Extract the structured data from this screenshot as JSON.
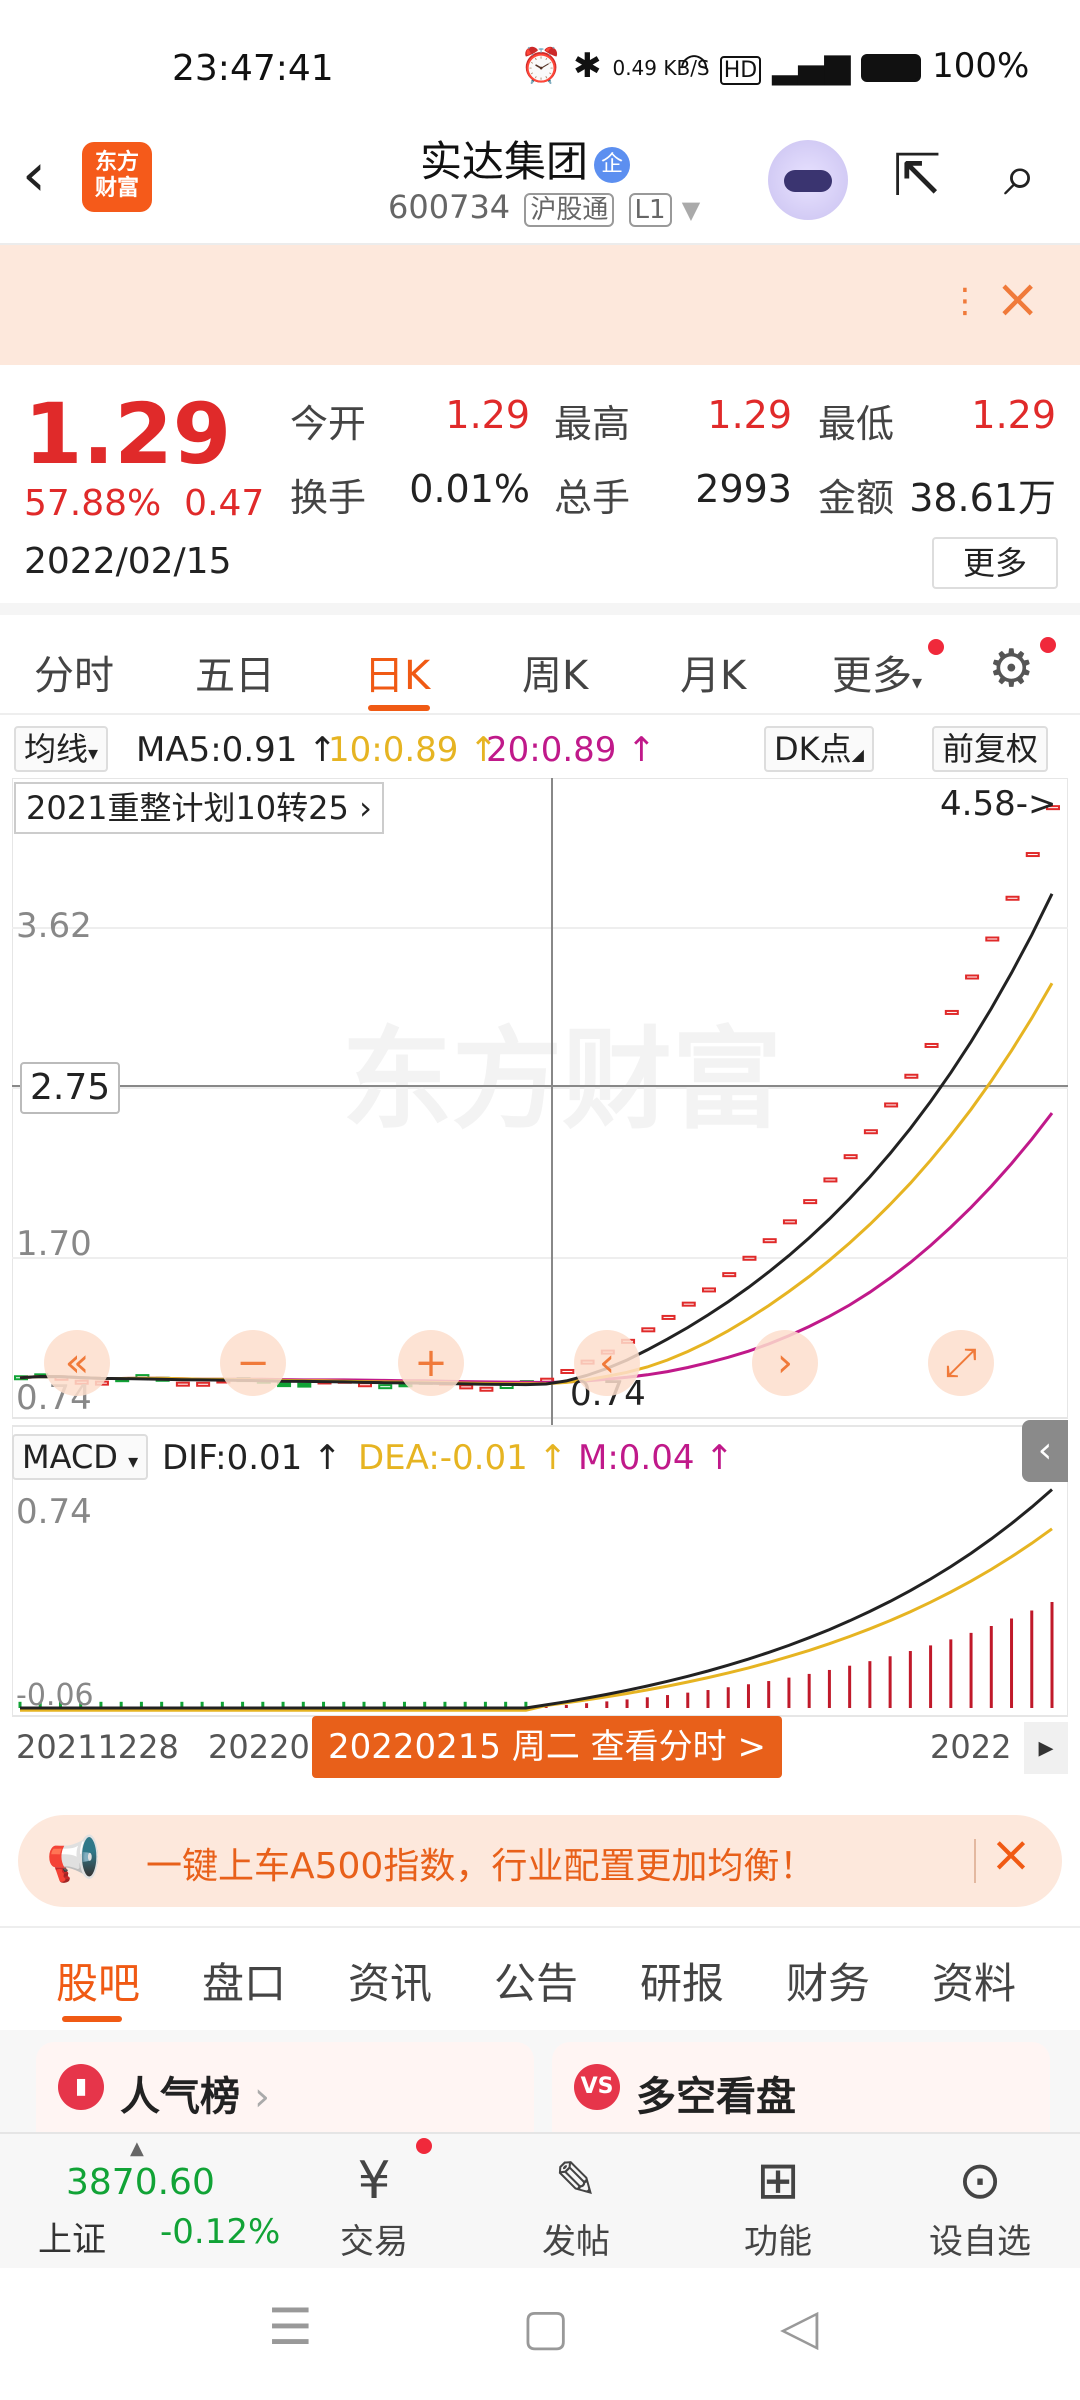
{
  "status_bar": {
    "time": "23:47:41",
    "network_speed": "0.49 KB/S",
    "battery": "100%"
  },
  "header": {
    "logo_text": "东方财富",
    "stock_name": "实达集团",
    "name_badge": "企",
    "stock_code": "600734",
    "connect_tag": "沪股通",
    "level_tag": "L1"
  },
  "banner": {
    "more_glyph": "⋮"
  },
  "quote": {
    "price": "1.29",
    "change_pct": "57.88%",
    "change_amt": "0.47",
    "date": "2022/02/15",
    "open_label": "今开",
    "open": "1.29",
    "high_label": "最高",
    "high": "1.29",
    "low_label": "最低",
    "low": "1.29",
    "turnover_label": "换手",
    "turnover": "0.01%",
    "volume_label": "总手",
    "volume": "2993",
    "amount_label": "金额",
    "amount": "38.61万",
    "more_button": "更多"
  },
  "tabs": [
    "分时",
    "五日",
    "日K",
    "周K",
    "月K",
    "更多"
  ],
  "active_tab": "日K",
  "ma_row": {
    "selector": "均线",
    "ma5": "MA5:0.91",
    "ma10": "10:0.89",
    "ma20": "20:0.89",
    "dk_button": "DK点",
    "fq_button": "前复权"
  },
  "chart": {
    "plan_label": "2021重整计划10转25",
    "max_label": "4.58->",
    "current_label": "2.75",
    "min_label": "0.74",
    "y_labels": [
      "3.62",
      "1.70",
      "0.74"
    ],
    "macd_selector": "MACD",
    "dif": "DIF:0.01",
    "dea": "DEA:-0.01",
    "m": "M:0.04",
    "macd_top": "0.74",
    "macd_bottom": "-0.06",
    "x_start": "20211228",
    "x_mid": "20220",
    "x_end": "2022",
    "date_badge": "20220215 周二 查看分时 >",
    "watermark": "东方财富",
    "colors": {
      "ma5": "#222222",
      "ma10": "#e6b422",
      "ma20": "#c0198a",
      "up": "#e02a2a",
      "down": "#11a336"
    }
  },
  "chart_data": {
    "type": "candlestick",
    "title": "",
    "price_axis": [
      0.74,
      1.7,
      2.75,
      3.62
    ],
    "x_range": [
      "20211228",
      "2022"
    ],
    "series": [
      {
        "name": "MA5",
        "value": 0.91
      },
      {
        "name": "10",
        "value": 0.89
      },
      {
        "name": "20",
        "value": 0.89
      }
    ],
    "highlight_date": "20220215",
    "max_price": 4.58,
    "min_price": 0.74,
    "macd": {
      "DIF": 0.01,
      "DEA": -0.01,
      "M": 0.04
    }
  },
  "ad": {
    "text": "一键上车A500指数，行业配置更加均衡！"
  },
  "bottom_tabs": [
    "股吧",
    "盘口",
    "资讯",
    "公告",
    "研报",
    "财务",
    "资料"
  ],
  "cards": [
    {
      "icon": "▮",
      "title": "人气榜"
    },
    {
      "icon": "VS",
      "title": "多空看盘"
    }
  ],
  "bottom_bar": {
    "index_value": "3870.60",
    "index_name": "上证",
    "index_change": "-0.12%",
    "items": [
      "交易",
      "发帖",
      "功能",
      "设自选"
    ]
  }
}
